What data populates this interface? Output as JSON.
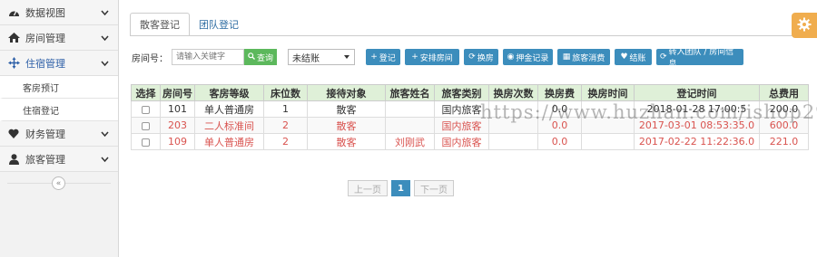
{
  "sidebar": {
    "items": [
      {
        "icon": "dashboard-icon",
        "label": "数据视图"
      },
      {
        "icon": "home-icon",
        "label": "房间管理"
      },
      {
        "icon": "move-icon",
        "label": "住宿管理"
      },
      {
        "sub": "客房预订"
      },
      {
        "sub": "住宿登记"
      },
      {
        "icon": "heart-icon",
        "label": "财务管理"
      },
      {
        "icon": "user-icon",
        "label": "旅客管理"
      }
    ],
    "collapse": "«"
  },
  "tabs": [
    "散客登记",
    "团队登记"
  ],
  "filter": {
    "room_label": "房间号：",
    "search_placeholder": "请输入关键字",
    "search_button": "查询",
    "status_value": "未结账"
  },
  "actions": [
    "登记",
    "安排房间",
    "换房",
    "押金记录",
    "旅客消费",
    "结账",
    "转入团队 / 房间信息"
  ],
  "table": {
    "headers": [
      "选择",
      "房间号",
      "客房等级",
      "床位数",
      "接待对象",
      "旅客姓名",
      "旅客类别",
      "换房次数",
      "换房费",
      "换房时间",
      "登记时间",
      "总费用"
    ],
    "rows": [
      [
        "",
        "101",
        "单人普通房",
        "1",
        "散客",
        "",
        "国内旅客",
        "",
        "0.0",
        "",
        "2018-01-28 17:00:5",
        "200.0"
      ],
      [
        "",
        "203",
        "二人标准间",
        "2",
        "散客",
        "",
        "国内旅客",
        "",
        "0.0",
        "",
        "2017-03-01 08:53:35.0",
        "600.0"
      ],
      [
        "",
        "109",
        "单人普通房",
        "2",
        "散客",
        "刘刚武",
        "国内旅客",
        "",
        "0.0",
        "",
        "2017-02-22 11:22:36.0",
        "221.0"
      ]
    ]
  },
  "pager": {
    "prev": "上一页",
    "current": "1",
    "next": "下一页"
  },
  "watermark": "https://www.huzhan.com/ishop29771",
  "colors": {
    "accent": "#3c8dbc",
    "header_bg": "#dff0d8",
    "alert_red": "#d9534f",
    "gear_bg": "#f0ad4e"
  }
}
